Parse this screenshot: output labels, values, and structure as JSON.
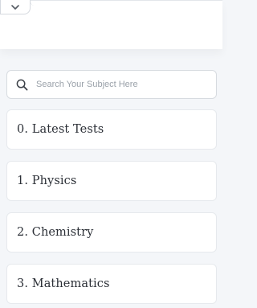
{
  "search": {
    "placeholder": "Search Your Subject Here"
  },
  "subjects": [
    {
      "label": "0. Latest Tests"
    },
    {
      "label": "1. Physics"
    },
    {
      "label": "2. Chemistry"
    },
    {
      "label": "3. Mathematics"
    }
  ],
  "icons": {
    "toggle": "chevron-down-icon",
    "search": "search-icon"
  },
  "colors": {
    "background": "#f4f6f9",
    "card": "#ffffff",
    "text": "#2b2f36",
    "placeholder": "#9aa1a9"
  }
}
